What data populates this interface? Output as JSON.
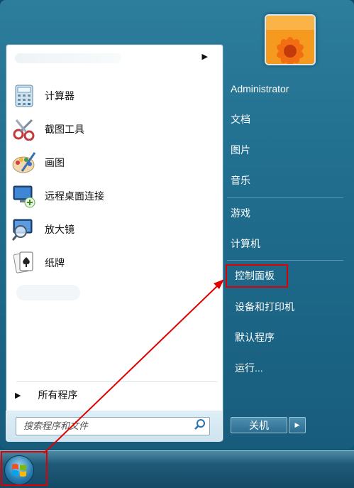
{
  "left_pane": {
    "pinned_arrow": "▶",
    "programs": [
      {
        "label": "计算器",
        "icon": "calculator-icon"
      },
      {
        "label": "截图工具",
        "icon": "snipping-tool-icon"
      },
      {
        "label": "画图",
        "icon": "paint-icon"
      },
      {
        "label": "远程桌面连接",
        "icon": "remote-desktop-icon"
      },
      {
        "label": "放大镜",
        "icon": "magnifier-icon"
      },
      {
        "label": "纸牌",
        "icon": "solitaire-icon"
      }
    ],
    "all_programs_arrow": "▶",
    "all_programs_label": "所有程序",
    "search_placeholder": "搜索程序和文件"
  },
  "right_pane": {
    "user_name": "Administrator",
    "items": [
      "文档",
      "图片",
      "音乐",
      "游戏",
      "计算机",
      "控制面板",
      "设备和打印机",
      "默认程序",
      "运行..."
    ],
    "highlighted_item": "控制面板",
    "shutdown_label": "关机",
    "shutdown_arrow": "▶"
  },
  "annotation": {
    "highlight_color": "#e00000"
  }
}
